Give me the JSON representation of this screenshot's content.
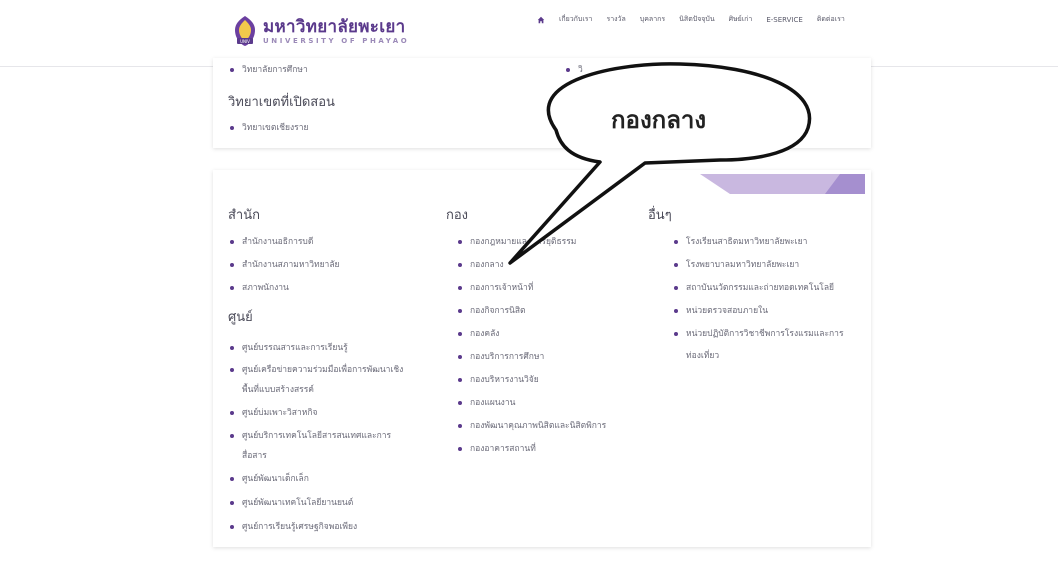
{
  "logo": {
    "th": "มหาวิทยาลัยพะเยา",
    "en": "UNIVERSITY OF PHAYAO",
    "badge": "UNIV"
  },
  "nav": {
    "home_icon": "home-icon",
    "items": [
      "เกี่ยวกับเรา",
      "รางวัล",
      "บุคลากร",
      "นิสิตปัจจุบัน",
      "ศิษย์เก่า",
      "E-SERVICE",
      "ติดต่อเรา"
    ]
  },
  "card1": {
    "item_top": "วิทยาลัยการศึกษา",
    "item_top_right": "วิ",
    "heading": "วิทยาเขตที่เปิดสอน",
    "campus_item": "วิทยาเขตเชียงราย"
  },
  "callout": {
    "text": "กองกลาง"
  },
  "card2": {
    "col1": {
      "heading1": "สำนัก",
      "items1": [
        "สำนักงานอธิการบดี",
        "สำนักงานสภามหาวิทยาลัย",
        "สภาพนักงาน"
      ],
      "heading2": "ศูนย์",
      "items2": [
        "ศูนย์บรรณสารและการเรียนรู้",
        "ศูนย์เครือข่ายความร่วมมือเพื่อการพัฒนาเชิง",
        "พื้นที่แบบสร้างสรรค์",
        "ศูนย์บ่มเพาะวิสาหกิจ",
        "ศูนย์บริการเทคโนโลยีสารสนเทศและการ",
        "สื่อสาร",
        "ศูนย์พัฒนาเด็กเล็ก",
        "ศูนย์พัฒนาเทคโนโลยียานยนต์",
        "ศูนย์การเรียนรู้เศรษฐกิจพอเพียง"
      ]
    },
    "col2": {
      "heading": "กอง",
      "items": [
        "กองกฎหมายและการยุติธรรม",
        "กองกลาง",
        "กองการเจ้าหน้าที่",
        "กองกิจการนิสิต",
        "กองคลัง",
        "กองบริการการศึกษา",
        "กองบริหารงานวิจัย",
        "กองแผนงาน",
        "กองพัฒนาคุณภาพนิสิตและนิสิตพิการ",
        "กองอาคารสถานที่"
      ]
    },
    "col3": {
      "heading": "อื่นๆ",
      "items": [
        "โรงเรียนสาธิตมหาวิทยาลัยพะเยา",
        "โรงพยาบาลมหาวิทยาลัยพะเยา",
        "สถาบันนวัตกรรมและถ่ายทอดเทคโนโลยี",
        "หน่วยตรวจสอบภายใน",
        "หน่วยปฏิบัติการวิชาชีพการโรงแรมและการ",
        "ท่องเที่ยว"
      ]
    }
  },
  "colors": {
    "brand": "#5b3a8c",
    "ribbon": "#c9b8e0",
    "ribbon_dark": "#a58fcf"
  }
}
